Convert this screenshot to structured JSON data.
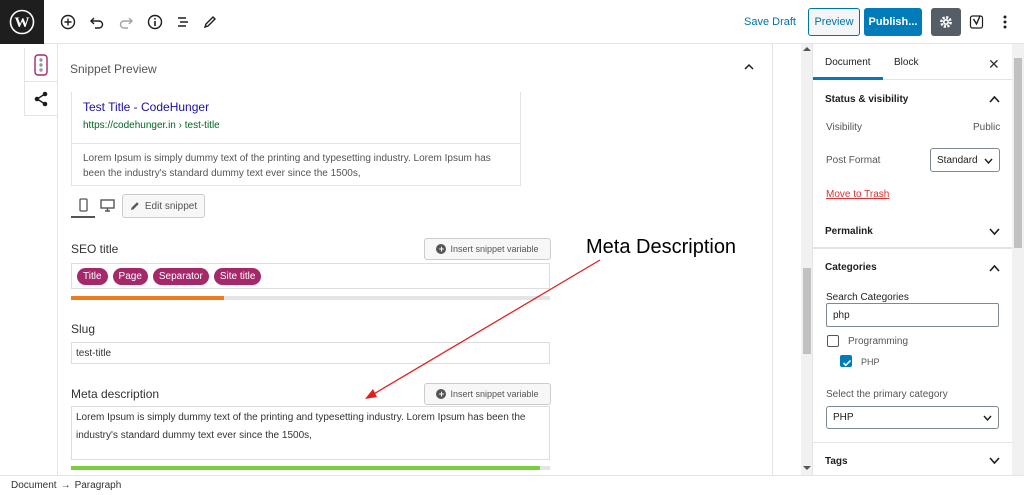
{
  "toolbar": {
    "save_draft": "Save Draft",
    "preview": "Preview",
    "publish": "Publish..."
  },
  "snippet": {
    "panel_title": "Snippet Preview",
    "title": "Test Title - CodeHunger",
    "url": "https://codehunger.in › test-title",
    "description": "Lorem Ipsum is simply dummy text of the printing and typesetting industry. Lorem Ipsum has been the industry's standard dummy text ever since the 1500s,",
    "edit_label": "Edit snippet"
  },
  "seo_title": {
    "label": "SEO title",
    "insert_label": "Insert snippet variable",
    "pills": [
      "Title",
      "Page",
      "Separator",
      "Site title"
    ],
    "progress": 0.32,
    "progress_color": "#ee7c1b"
  },
  "slug": {
    "label": "Slug",
    "value": "test-title"
  },
  "meta": {
    "label": "Meta description",
    "insert_label": "Insert snippet variable",
    "value": "Lorem Ipsum is simply dummy text of the printing and typesetting industry. Lorem Ipsum has been the industry's standard dummy text ever since the 1500s,",
    "progress": 0.98,
    "progress_color": "#7ad03a"
  },
  "annotation": {
    "text": "Meta Description",
    "color": "#e02020"
  },
  "sidebar": {
    "tab_document": "Document",
    "tab_block": "Block",
    "status_title": "Status & visibility",
    "visibility_label": "Visibility",
    "visibility_value": "Public",
    "post_format_label": "Post Format",
    "post_format_value": "Standard",
    "trash_label": "Move to Trash",
    "permalink_title": "Permalink",
    "categories_title": "Categories",
    "search_label": "Search Categories",
    "search_value": "php",
    "categories": [
      {
        "label": "Programming",
        "checked": false
      },
      {
        "label": "PHP",
        "checked": true
      }
    ],
    "primary_label": "Select the primary category",
    "primary_value": "PHP",
    "tags_title": "Tags"
  },
  "footer": {
    "crumb_1": "Document",
    "separator": "→",
    "crumb_2": "Paragraph"
  },
  "colors": {
    "accent": "#007cba",
    "yoast_pill": "#a4286a",
    "wp_logo_bg": "#1e1e1e"
  }
}
